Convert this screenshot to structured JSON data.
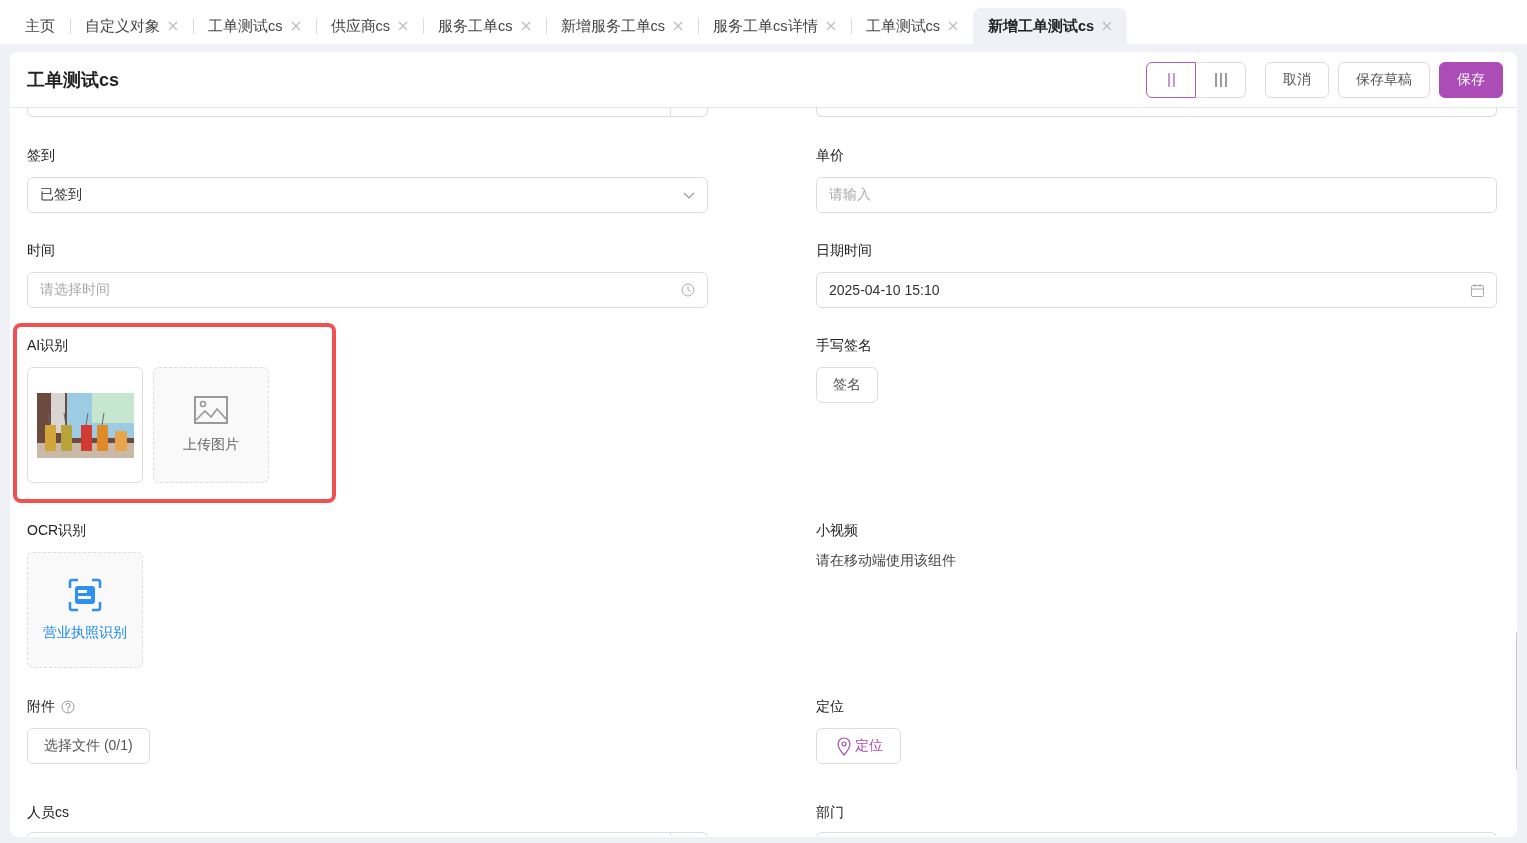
{
  "tabs": [
    {
      "label": "主页",
      "closable": false,
      "selected": false
    },
    {
      "label": "自定义对象",
      "closable": true,
      "selected": false
    },
    {
      "label": "工单测试cs",
      "closable": true,
      "selected": false
    },
    {
      "label": "供应商cs",
      "closable": true,
      "selected": false
    },
    {
      "label": "服务工单cs",
      "closable": true,
      "selected": false
    },
    {
      "label": "新增服务工单cs",
      "closable": true,
      "selected": false
    },
    {
      "label": "服务工单cs详情",
      "closable": true,
      "selected": false
    },
    {
      "label": "工单测试cs",
      "closable": true,
      "selected": false
    },
    {
      "label": "新增工单测试cs",
      "closable": true,
      "selected": true
    }
  ],
  "header": {
    "title": "工单测试cs",
    "layout_toggles": [
      {
        "kind": "two",
        "selected": true
      },
      {
        "kind": "three",
        "selected": false
      }
    ],
    "buttons": [
      {
        "label": "取消",
        "kind": "default"
      },
      {
        "label": "保存草稿",
        "kind": "default"
      },
      {
        "label": "保存",
        "kind": "primary"
      }
    ]
  },
  "fields": [
    {
      "kind": "cut_suffix"
    },
    {
      "kind": "cut_input"
    },
    {
      "kind": "select",
      "label": "签到",
      "value": "已签到"
    },
    {
      "kind": "input",
      "label": "单价",
      "placeholder": "请输入"
    },
    {
      "kind": "time",
      "label": "时间",
      "placeholder": "请选择时间"
    },
    {
      "kind": "datetime",
      "label": "日期时间",
      "value": "2025-04-10 15:10"
    },
    {
      "kind": "image_upload",
      "label": "AI识别",
      "highlighted": true,
      "upload_label": "上传图片"
    },
    {
      "kind": "button",
      "label": "手写签名",
      "button": "签名"
    },
    {
      "kind": "ocr",
      "label": "OCR识别",
      "action": "营业执照识别"
    },
    {
      "kind": "note",
      "label": "小视频",
      "text": "请在移动端使用该组件"
    },
    {
      "kind": "file",
      "label": "附件",
      "help": true,
      "button": "选择文件 (0/1)"
    },
    {
      "kind": "location",
      "label": "定位",
      "button": "定位"
    },
    {
      "kind": "bottom_suffix",
      "label": "人员cs"
    },
    {
      "kind": "bottom_input",
      "label": "部门"
    }
  ]
}
